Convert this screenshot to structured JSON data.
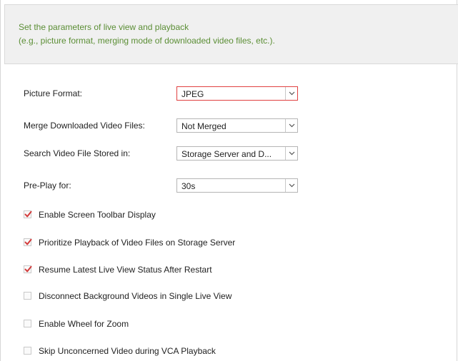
{
  "banner": {
    "line1": "Set the parameters of live view and playback",
    "line2": "(e.g., picture format, merging mode of downloaded video files, etc.)."
  },
  "fields": [
    {
      "label": "Picture Format:",
      "value": "JPEG"
    },
    {
      "label": "Merge Downloaded Video Files:",
      "value": "Not Merged"
    },
    {
      "label": "Search Video File Stored in:",
      "value": "Storage Server and D..."
    },
    {
      "label": "Pre-Play for:",
      "value": "30s"
    }
  ],
  "options": [
    {
      "label": "Enable Screen Toolbar Display",
      "checked": true
    },
    {
      "label": "Prioritize Playback of Video Files on Storage Server",
      "checked": true
    },
    {
      "label": "Resume Latest Live View Status After Restart",
      "checked": true
    },
    {
      "label": "Disconnect Background Videos in Single Live View",
      "checked": false
    },
    {
      "label": "Enable Wheel for Zoom",
      "checked": false
    },
    {
      "label": "Skip Unconcerned Video during VCA Playback",
      "checked": false
    }
  ],
  "colors": {
    "banner_text": "#5b8e35",
    "check_mark": "#d23a3a",
    "focus_border": "#e04040"
  },
  "icons": {
    "dropdown": "chevron-down-icon",
    "check": "checkmark-icon"
  }
}
